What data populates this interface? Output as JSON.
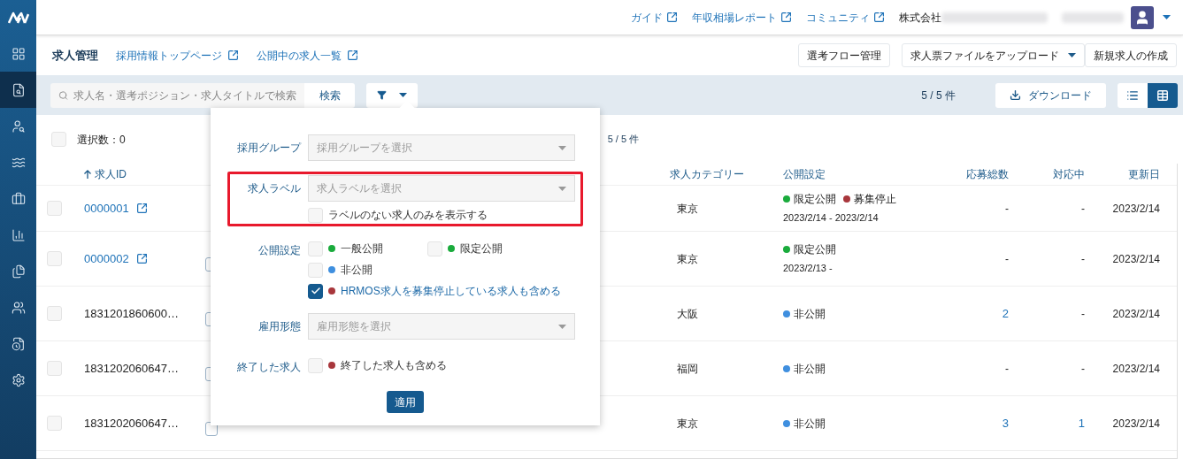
{
  "topbar": {
    "links": [
      {
        "label": "ガイド"
      },
      {
        "label": "年収相場レポート"
      },
      {
        "label": "コミュニティ"
      }
    ],
    "company": "株式会社"
  },
  "sidebar": {
    "items": [
      {
        "selected": false
      },
      {
        "selected": true
      },
      {
        "selected": false
      },
      {
        "selected": false
      },
      {
        "selected": false
      },
      {
        "selected": false
      },
      {
        "selected": false
      },
      {
        "selected": false
      },
      {
        "selected": false
      },
      {
        "selected": false
      }
    ]
  },
  "header": {
    "title": "求人管理",
    "links": [
      {
        "label": "採用情報トップページ"
      },
      {
        "label": "公開中の求人一覧"
      }
    ],
    "buttons": [
      {
        "label": "選考フロー管理",
        "kind": "plain"
      },
      {
        "label": "求人票ファイルをアップロード",
        "kind": "dropdown"
      },
      {
        "label": "新規求人の作成",
        "kind": "plain"
      }
    ]
  },
  "toolbar": {
    "search": {
      "placeholder": "求人名・選考ポジション・求人タイトルで検索"
    },
    "search_button": "検索",
    "count": "5 / 5 件",
    "download": "ダウンロード",
    "views": [
      {
        "selected": false
      },
      {
        "selected": true
      }
    ]
  },
  "selection": {
    "label": "選択数：0",
    "checked": false,
    "count": "5 / 5 件"
  },
  "table": {
    "columns": [
      "求人ID",
      "求人カテゴリー",
      "公開設定",
      "応募総数",
      "対応中",
      "更新日"
    ],
    "rows": [
      {
        "checked": false,
        "id": "0000001",
        "link": true,
        "category": "東京",
        "statuses": [
          {
            "label": "限定公開",
            "color": "#1aab3c"
          },
          {
            "label": "募集停止",
            "color": "#a8373c"
          }
        ],
        "period": "2023/2/14 - 2023/2/14",
        "applicants": {
          "text": "-",
          "link": false
        },
        "active": {
          "text": "-",
          "link": false
        },
        "updated": "2023/2/14"
      },
      {
        "checked": false,
        "id": "0000002",
        "link": true,
        "column_2": {
          "kind": "tag"
        },
        "category": "東京",
        "statuses": [
          {
            "label": "限定公開",
            "color": "#1aab3c"
          }
        ],
        "period": "2023/2/13 -",
        "applicants": {
          "text": "-",
          "link": false
        },
        "active": {
          "text": "-",
          "link": false
        },
        "updated": "2023/2/14"
      },
      {
        "checked": false,
        "id": "1831201860600…",
        "link": false,
        "column_2": {
          "kind": "tag"
        },
        "category": "大阪",
        "statuses": [
          {
            "label": "非公開",
            "color": "#3f8fdf"
          }
        ],
        "applicants": {
          "text": "2",
          "link": true
        },
        "active": {
          "text": "-",
          "link": false
        },
        "updated": "2023/2/14"
      },
      {
        "checked": false,
        "id": "1831202060647…",
        "link": false,
        "column_2": {
          "kind": "tag"
        },
        "category": "福岡",
        "statuses": [
          {
            "label": "非公開",
            "color": "#3f8fdf"
          }
        ],
        "applicants": {
          "text": "-",
          "link": false
        },
        "active": {
          "text": "-",
          "link": false
        },
        "updated": "2023/2/14"
      },
      {
        "checked": false,
        "id": "1831202060647…",
        "link": false,
        "column_2": {
          "kind": "tag"
        },
        "category": "東京",
        "statuses": [
          {
            "label": "非公開",
            "color": "#3f8fdf"
          }
        ],
        "applicants": {
          "text": "3",
          "link": true
        },
        "active": {
          "text": "1",
          "link": true
        },
        "updated": "2023/2/14"
      }
    ]
  },
  "filter_panel": {
    "rows": [
      {
        "kind": "select",
        "label": "採用グループ",
        "placeholder": "採用グループを選択"
      },
      {
        "kind": "select",
        "label": "求人ラベル",
        "placeholder": "求人ラベルを選択",
        "highlighted": true,
        "options": [
          {
            "label": "ラベルのない求人のみを表示する",
            "checked": false
          }
        ]
      },
      {
        "kind": "checks",
        "label": "公開設定",
        "options": [
          {
            "label": "一般公開",
            "checked": false,
            "color": "#1aab3c"
          },
          {
            "label": "限定公開",
            "checked": false,
            "color": "#1aab3c"
          },
          {
            "label": "非公開",
            "checked": false,
            "color": "#3f8fdf"
          },
          {
            "label": "HRMOS求人を募集停止している求人も含める",
            "checked": true,
            "color": "#a8373c"
          }
        ]
      },
      {
        "kind": "select",
        "label": "雇用形態",
        "placeholder": "雇用形態を選択"
      },
      {
        "kind": "checks",
        "label": "終了した求人",
        "options": [
          {
            "label": "終了した求人も含める",
            "checked": false,
            "color": "#a8373c"
          }
        ]
      }
    ],
    "apply": "適用"
  }
}
